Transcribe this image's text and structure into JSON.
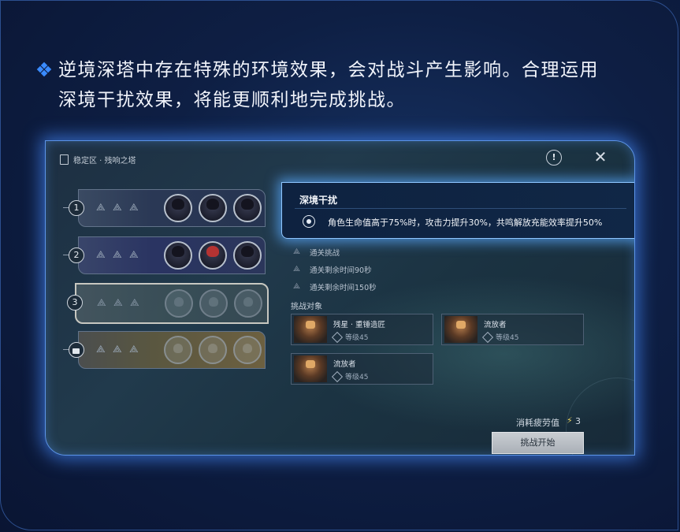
{
  "caption": {
    "line1": "逆境深塔中存在特殊的环境效果，会对战斗产生影响。合理运用",
    "line2": "深境干扰效果，将能更顺利地完成挑战。"
  },
  "panel": {
    "breadcrumb": "稳定区 · 残响之塔",
    "alert_symbol": "!",
    "close_symbol": "✕"
  },
  "floors": [
    {
      "label": "1",
      "state": "cleared"
    },
    {
      "label": "2",
      "state": "cleared"
    },
    {
      "label": "3",
      "state": "selected"
    },
    {
      "label": "",
      "state": "locked"
    }
  ],
  "tooltip": {
    "title": "深境干扰",
    "effect": "角色生命值高于75%时，攻击力提升30%，共鸣解放充能效率提升50%"
  },
  "conditions": [
    "通关挑战",
    "通关剩余时间90秒",
    "通关剩余时间150秒"
  ],
  "targets_label": "挑战对象",
  "enemies": [
    {
      "name": "残星 · 重锤造匠",
      "level": "等级45"
    },
    {
      "name": "流放者",
      "level": "等级45"
    },
    {
      "name": "流放者",
      "level": "等级45"
    }
  ],
  "footer": {
    "fatigue_label": "消耗疲劳值",
    "bolt_symbol": "⚡",
    "fatigue_value": "3",
    "start_label": "挑战开始"
  },
  "colors": {
    "accent": "#3a8bff",
    "tooltip_border": "#8fc6ff",
    "panel_glow": "#468cff"
  }
}
